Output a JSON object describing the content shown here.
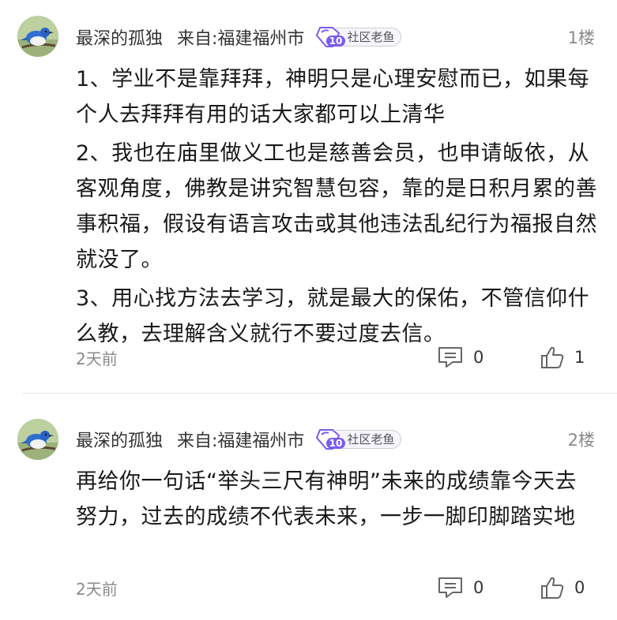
{
  "comments": [
    {
      "avatar_icon": "bluebird-avatar",
      "username": "最深的孤独",
      "location": "来自:福建福州市",
      "badge": {
        "icon": "level-10-badge",
        "label": "社区老鱼",
        "color": "#7b5cf0"
      },
      "floor": "1楼",
      "paragraphs": [
        "1、学业不是靠拜拜，神明只是心理安慰而已，如果每个人去拜拜有用的话大家都可以上清华",
        "2、我也在庙里做义工也是慈善会员，也申请皈依，从客观角度，佛教是讲究智慧包容，靠的是日积月累的善事积福，假设有语言攻击或其他违法乱纪行为福报自然就没了。",
        "3、用心找方法去学习，就是最大的保佑，不管信仰什么教，去理解含义就行不要过度去信。"
      ],
      "time": "2天前",
      "reply_icon": "comment-icon",
      "reply_count": "0",
      "like_icon": "thumbs-up-icon",
      "like_count": "1"
    },
    {
      "avatar_icon": "bluebird-avatar",
      "username": "最深的孤独",
      "location": "来自:福建福州市",
      "badge": {
        "icon": "level-10-badge",
        "label": "社区老鱼",
        "color": "#7b5cf0"
      },
      "floor": "2楼",
      "paragraphs": [
        "再给你一句话“举头三尺有神明”未来的成绩靠今天去努力，过去的成绩不代表未来，一步一脚印脚踏实地"
      ],
      "time": "2天前",
      "reply_icon": "comment-icon",
      "reply_count": "0",
      "like_icon": "thumbs-up-icon",
      "like_count": "0"
    }
  ]
}
